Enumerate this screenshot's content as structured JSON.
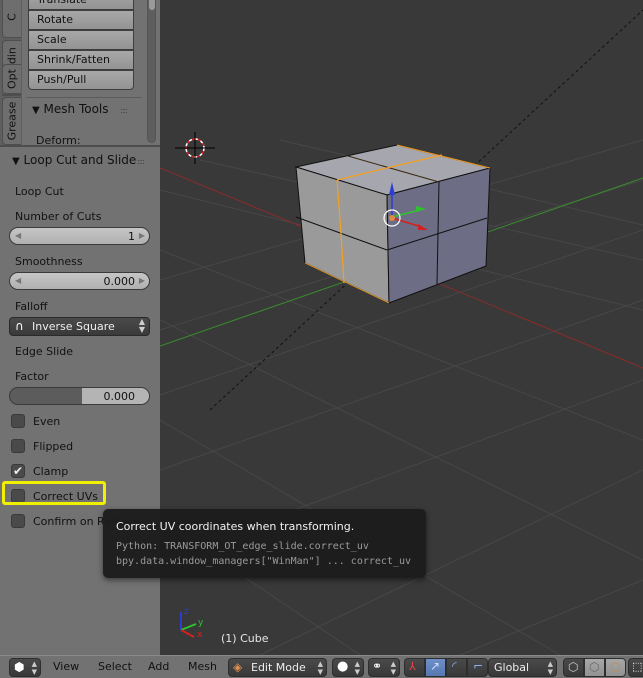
{
  "shelf": {
    "tabs": [
      "C",
      "Shadin",
      "Opt",
      "Grease"
    ],
    "transform_buttons": [
      "Translate",
      "Rotate",
      "Scale",
      "Shrink/Fatten",
      "Push/Pull"
    ],
    "mesh_tools_header": "Mesh Tools",
    "deform_label": "Deform:"
  },
  "operator": {
    "title": "Loop Cut and Slide",
    "loop_cut_label": "Loop Cut",
    "number_of_cuts_label": "Number of Cuts",
    "number_of_cuts_value": "1",
    "smoothness_label": "Smoothness",
    "smoothness_value": "0.000",
    "falloff_label": "Falloff",
    "falloff_value": "Inverse Square",
    "edge_slide_label": "Edge Slide",
    "factor_label": "Factor",
    "factor_value": "0.000",
    "checkboxes": [
      {
        "label": "Even",
        "checked": false
      },
      {
        "label": "Flipped",
        "checked": false
      },
      {
        "label": "Clamp",
        "checked": true
      },
      {
        "label": "Correct UVs",
        "checked": false
      },
      {
        "label": "Confirm on Release",
        "checked": false
      }
    ],
    "highlight_color": "#f0f000"
  },
  "tooltip": {
    "description": "Correct UV coordinates when transforming.",
    "python": "Python: TRANSFORM_OT_edge_slide.correct_uv",
    "path": "bpy.data.window_managers[\"WinMan\"] ... correct_uv"
  },
  "viewport": {
    "object_label": "(1) Cube",
    "axis_labels": {
      "x": "x",
      "y": "y",
      "z": "z"
    },
    "colors": {
      "x_axis": "#c42b2b",
      "y_axis": "#3fa13f",
      "z_axis": "#2a3fd0",
      "selected_edge": "#f5a020"
    }
  },
  "header": {
    "menus": [
      "View",
      "Select",
      "Add",
      "Mesh"
    ],
    "mode": "Edit Mode",
    "orientation": "Global"
  }
}
